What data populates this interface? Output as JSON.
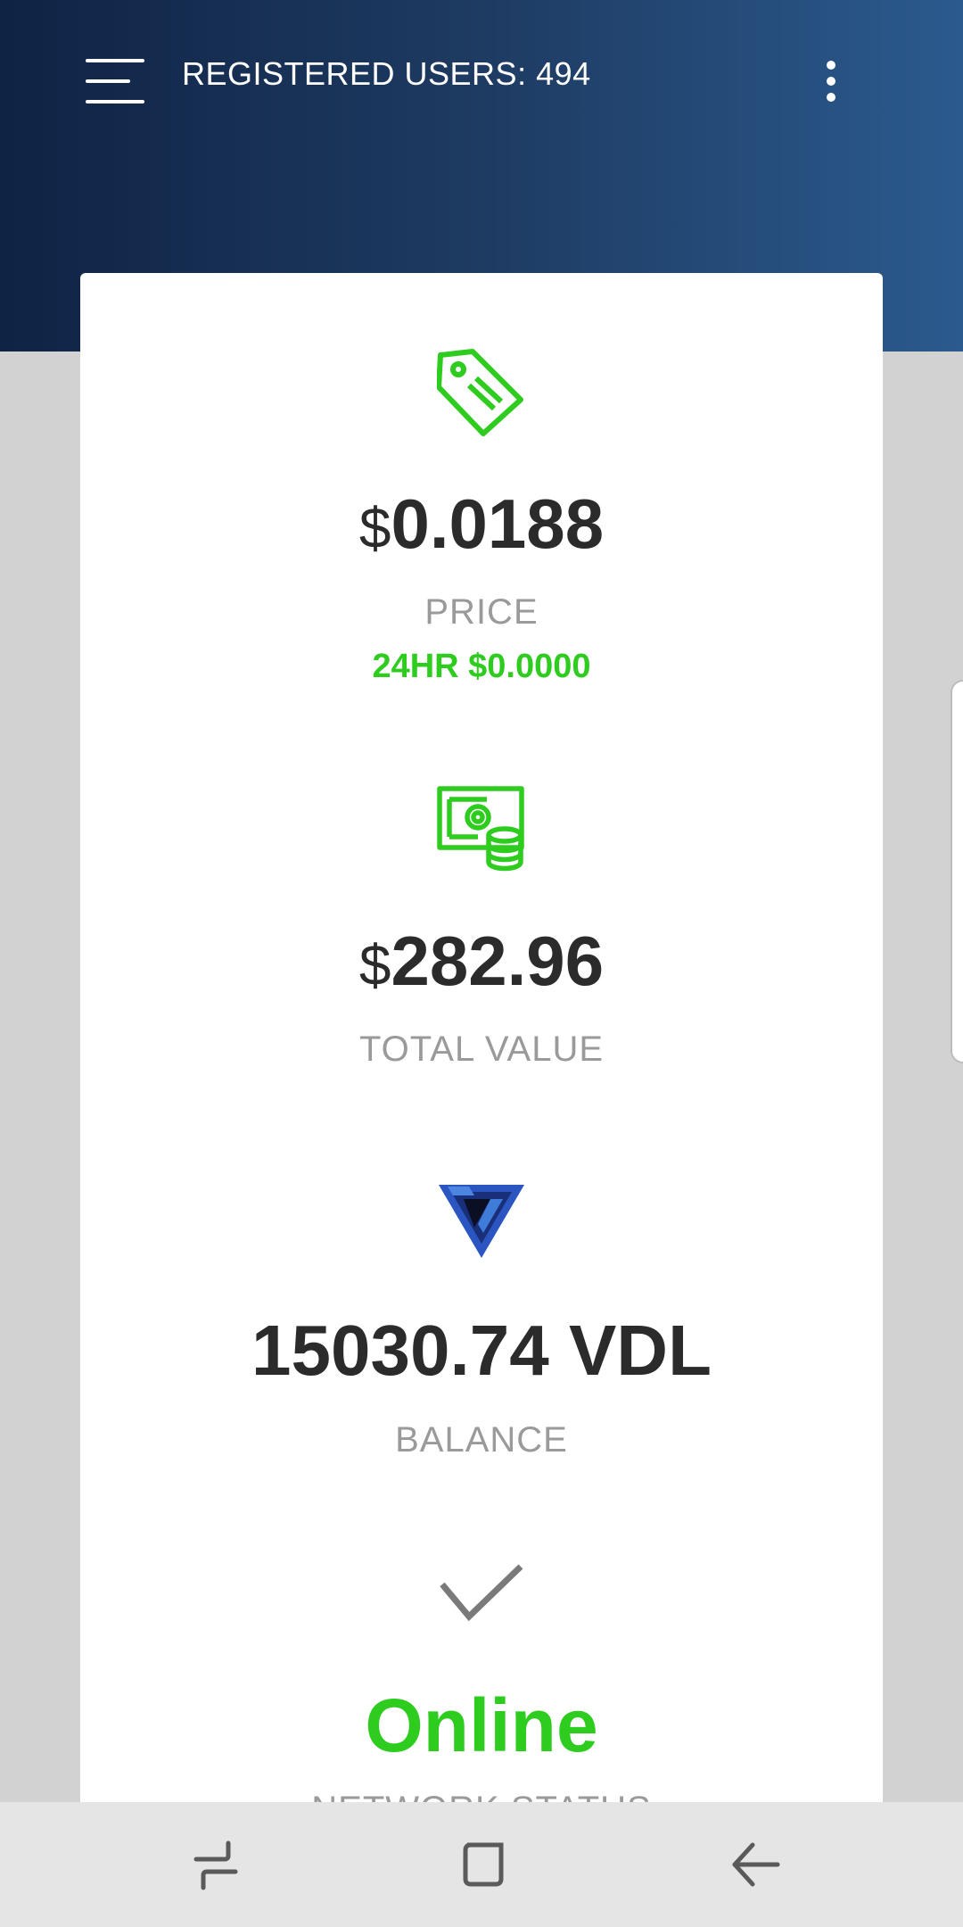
{
  "header": {
    "title": "REGISTERED USERS: 494",
    "menu_icon": "hamburger-menu-icon",
    "overflow_icon": "more-vert-icon",
    "gradient": [
      "#0f2344",
      "#2b5a8e"
    ]
  },
  "stats": {
    "price": {
      "icon": "price-tag-icon",
      "currency": "$",
      "value": "0.0188",
      "label": "PRICE",
      "change": "24HR $0.0000"
    },
    "total_value": {
      "icon": "money-coins-icon",
      "currency": "$",
      "value": "282.96",
      "label": "TOTAL VALUE"
    },
    "balance": {
      "icon": "vdl-logo-icon",
      "value": "15030.74 VDL",
      "label": "BALANCE"
    },
    "network": {
      "icon": "checkmark-icon",
      "status": "Online",
      "label": "NETWORK STATUS"
    }
  },
  "colors": {
    "accent_green": "#2ecc1f",
    "text_dark": "#2b2b2b",
    "text_muted": "#9a9a9a",
    "background": "#d2d2d2"
  },
  "navbar": {
    "recents_icon": "recent-apps-icon",
    "home_icon": "home-icon",
    "back_icon": "back-icon"
  }
}
